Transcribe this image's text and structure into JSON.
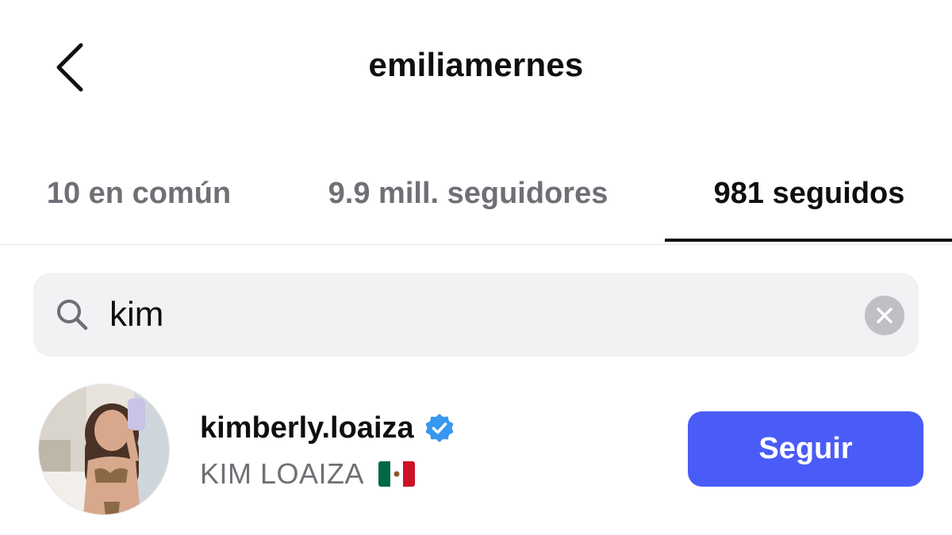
{
  "header": {
    "title": "emiliamernes",
    "back_icon": "chevron-left-icon"
  },
  "tabs": [
    {
      "label": "10 en común",
      "active": false
    },
    {
      "label": "9.9 mill. seguidores",
      "active": false
    },
    {
      "label": "981 seguidos",
      "active": true
    }
  ],
  "search": {
    "value": "kim",
    "search_icon": "search-icon",
    "clear_icon": "clear-icon"
  },
  "results": [
    {
      "username": "kimberly.loaiza",
      "verified": true,
      "full_name": "KIM LOAIZA",
      "flag": "mexico-flag",
      "action_label": "Seguir"
    }
  ],
  "colors": {
    "accent": "#4a5cf7",
    "verified": "#3897f0",
    "text_primary": "#0f0f0f",
    "text_secondary": "#6e7076",
    "search_bg": "#f1f2f4"
  }
}
